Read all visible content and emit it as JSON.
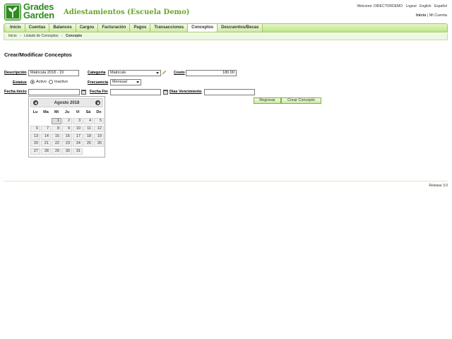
{
  "logo": {
    "line1": "Grades",
    "line2": "Garden"
  },
  "app_title": "Adiestamientos (Escuela Demo)",
  "top_links": {
    "welcome": "Welcome: DIRECTORDEMO",
    "logout": "Logout",
    "english": "English",
    "espanol": "Español"
  },
  "sub_links": {
    "inicio": "Inicio",
    "sep": "|",
    "mi_cuenta": "Mi Cuenta"
  },
  "nav": {
    "items": [
      {
        "label": "Inicio"
      },
      {
        "label": "Cuentas"
      },
      {
        "label": "Balances"
      },
      {
        "label": "Cargos"
      },
      {
        "label": "Facturación"
      },
      {
        "label": "Pagos"
      },
      {
        "label": "Transacciones"
      },
      {
        "label": "Conceptos",
        "active": true
      },
      {
        "label": "Descuentos/Becas"
      }
    ]
  },
  "breadcrumb": {
    "items": [
      "Inicio",
      "Listado de Conceptos",
      "Concepto"
    ]
  },
  "page_title": "Crear/Modificar Conceptos",
  "form": {
    "descripcion_label": "Descripción",
    "descripcion_value": "Matricula 2018 - 19",
    "categoria_label": "Categoría",
    "categoria_value": "Matricule",
    "costo_label": "Costo",
    "costo_value": "180.00",
    "estatus_label": "Estatus",
    "activo_label": "Activo",
    "inactivo_label": "Inactivo",
    "frecuencia_label": "Frecuencia",
    "frecuencia_value": "Mensual",
    "fecha_inicio_label": "Fecha Inicio",
    "fecha_inicio_value": "",
    "fecha_fin_label": "Fecha Fin",
    "fecha_fin_value": "",
    "dias_vencimiento_label": "Dias Vencimiento",
    "dias_vencimiento_value": "",
    "regresar_label": "Regresar",
    "crear_label": "Crear Concepto"
  },
  "datepicker": {
    "title": "Agosto 2018",
    "dow": [
      "Lu",
      "Ma",
      "Mi",
      "Ju",
      "Vi",
      "Sá",
      "Do"
    ],
    "selected_day": "1",
    "weeks": [
      [
        "",
        "",
        "1",
        "2",
        "3",
        "4",
        "5"
      ],
      [
        "6",
        "7",
        "8",
        "9",
        "10",
        "11",
        "12"
      ],
      [
        "13",
        "14",
        "15",
        "16",
        "17",
        "18",
        "19"
      ],
      [
        "20",
        "21",
        "22",
        "23",
        "24",
        "25",
        "26"
      ],
      [
        "27",
        "28",
        "29",
        "30",
        "31",
        "",
        ""
      ]
    ]
  },
  "footer": {
    "release": "Release 3.0"
  },
  "colors": {
    "brand": "#2e8b1e",
    "accent": "#6aa52a",
    "nav_bg": "#cdeaa3"
  }
}
